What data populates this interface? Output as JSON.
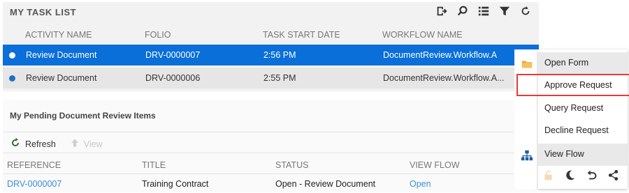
{
  "task_list": {
    "title": "MY TASK LIST",
    "toolbar_icons": [
      "exit-icon",
      "search-icon",
      "list-icon",
      "filter-icon",
      "refresh-icon"
    ],
    "columns": [
      "ACTIVITY NAME",
      "FOLIO",
      "TASK START DATE",
      "WORKFLOW NAME"
    ],
    "rows": [
      {
        "activity": "Review Document",
        "folio": "DRV-0000007",
        "start": "2:56 PM",
        "workflow": "DocumentReview.Workflow.A",
        "selected": true
      },
      {
        "activity": "Review Document",
        "folio": "DRV-0000006",
        "start": "2:55 PM",
        "workflow": "DocumentReview.Workflow.A...",
        "selected": false
      }
    ]
  },
  "pending": {
    "title": "My Pending Document Review Items",
    "toolbar": {
      "refresh_label": "Refresh",
      "view_label": "View"
    },
    "columns": [
      "REFERENCE",
      "TITLE",
      "STATUS",
      "VIEW FLOW"
    ],
    "rows": [
      {
        "reference": "DRV-0000007",
        "title": "Training Contract",
        "status": "Open - Review Document",
        "view_flow": "Open"
      }
    ]
  },
  "context_menu": {
    "items": [
      "Open Form",
      "Approve Request",
      "Query Request",
      "Decline Request",
      "View Flow"
    ],
    "highlighted": "Approve Request",
    "bottom_icons": [
      "unlock-icon",
      "moon-icon",
      "undo-icon",
      "share-icon"
    ]
  },
  "colors": {
    "selected_row": "#0a6fd8",
    "link": "#3a8ed8",
    "highlight_border": "#e53b3b"
  }
}
